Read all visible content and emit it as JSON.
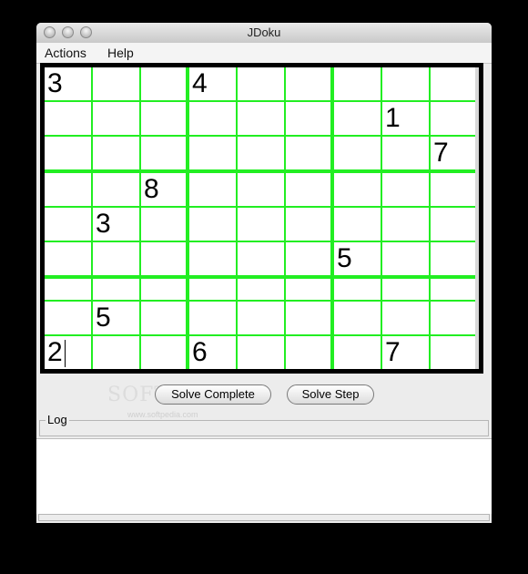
{
  "window": {
    "title": "JDoku"
  },
  "menubar": {
    "items": [
      "Actions",
      "Help"
    ]
  },
  "board": {
    "cells": [
      [
        "3",
        "",
        "",
        "4",
        "",
        "",
        "",
        "",
        ""
      ],
      [
        "",
        "",
        "",
        "",
        "",
        "",
        "",
        "1",
        ""
      ],
      [
        "",
        "",
        "",
        "",
        "",
        "",
        "",
        "",
        "7"
      ],
      [
        "",
        "",
        "8",
        "",
        "",
        "",
        "",
        "",
        ""
      ],
      [
        "",
        "3",
        "",
        "",
        "",
        "",
        "",
        "",
        ""
      ],
      [
        "",
        "",
        "",
        "",
        "",
        "",
        "5",
        "",
        ""
      ],
      [
        "",
        "",
        "",
        "",
        "",
        "",
        "",
        "",
        ""
      ],
      [
        "",
        "5",
        "",
        "",
        "",
        "",
        "",
        "",
        ""
      ],
      [
        "2",
        "",
        "",
        "6",
        "",
        "",
        "",
        "7",
        ""
      ]
    ],
    "colors": {
      "grid_lines": "#22ee22",
      "frame": "#000000"
    }
  },
  "buttons": {
    "solve_complete": "Solve Complete",
    "solve_step": "Solve Step"
  },
  "watermark": {
    "text": "SOFTPEDIA",
    "sub": "www.softpedia.com"
  },
  "log": {
    "label": "Log",
    "content": ""
  }
}
